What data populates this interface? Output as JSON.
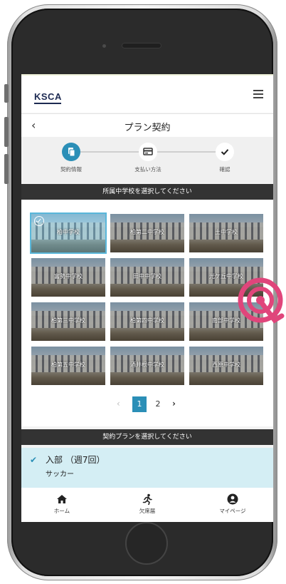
{
  "header": {
    "logo": "KSCA"
  },
  "titlebar": {
    "back": "<",
    "title": "プラン契約"
  },
  "steps": [
    {
      "label": "契約情報",
      "icon": "document-icon",
      "active": true
    },
    {
      "label": "支払い方法",
      "icon": "credit-card-icon",
      "active": false
    },
    {
      "label": "確認",
      "icon": "checkmark-icon",
      "active": false
    }
  ],
  "school_section": {
    "heading": "所属中学校を選択してください",
    "schools": [
      "柏中学校",
      "柏第二中学校",
      "土中学校",
      "富勢中学校",
      "田中中学校",
      "光ケ丘中学校",
      "柏第三中学校",
      "柏第四中学校",
      "南部中学校",
      "柏第五中学校",
      "酒井根中学校",
      "西原中学校"
    ],
    "selected": "柏中学校"
  },
  "pagination": {
    "prev": "<",
    "pages": [
      "1",
      "2"
    ],
    "current": "1",
    "next": ">"
  },
  "plan_section": {
    "heading": "契約プランを選択してください",
    "plan_title": "入部 （週7回）",
    "plan_sub": "サッカー"
  },
  "tabs": [
    {
      "label": "ホーム",
      "icon": "home-icon"
    },
    {
      "label": "欠席届",
      "icon": "running-person-icon"
    },
    {
      "label": "マイページ",
      "icon": "user-icon"
    }
  ],
  "colors": {
    "accent": "#2b8fb7",
    "section_bar": "#333333",
    "plan_highlight": "#d4eef4",
    "overlay": "#e0457b"
  }
}
